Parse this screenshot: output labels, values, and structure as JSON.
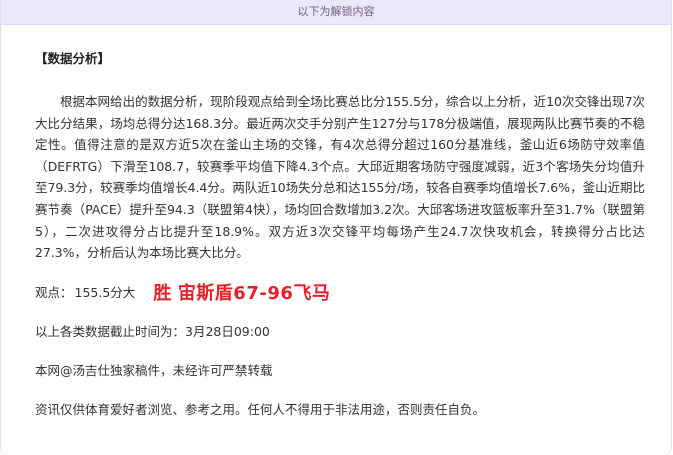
{
  "banner": {
    "text": "以下为解锁内容"
  },
  "article": {
    "section_title": "【数据分析】",
    "analysis_text": "根据本网给出的数据分析，现阶段观点给到全场比赛总比分155.5分，综合以上分析，近10次交锋出现7次大比分结果，场均总得分达168.3分。最近两次交手分别产生127分与178分极端值，展现两队比赛节奏的不稳定性。值得注意的是双方近5次在釜山主场的交锋，有4次总得分超过160分基准线，釜山近6场防守效率值（DEFRTG）下滑至108.7，较赛季平均值下降4.3个点。大邱近期客场防守强度减弱，近3个客场失分均值升至79.3分，较赛季均值增长4.4分。两队近10场失分总和达155分/场，较各自赛季均值增长7.6%，釜山近期比赛节奏（PACE）提升至94.3（联盟第4快），场均回合数增加3.2次。大邱客场进攻篮板率升至31.7%（联盟第5），二次进攻得分占比提升至18.9%。双方近3次交锋平均每场产生24.7次快攻机会，转换得分占比达27.3%，分析后认为本场比赛大比分。",
    "pick_label": "观点：",
    "pick_value": "155.5分大",
    "pick_result_prefix": "胜",
    "pick_result_matchup": "宙斯盾67-96飞马",
    "deadline": "以上各类数据截止时间为：3月28日09:00",
    "copyright": "本网@汤吉仕独家稿件，未经许可严禁转载",
    "disclaimer": "资讯仅供体育爱好者浏览、参考之用。任何人不得用于非法用途，否则责任自负。"
  },
  "colors": {
    "banner_bg": "#ece8f8",
    "banner_text": "#6a5f86",
    "result_red": "#e8202a",
    "body_text": "#333333"
  }
}
